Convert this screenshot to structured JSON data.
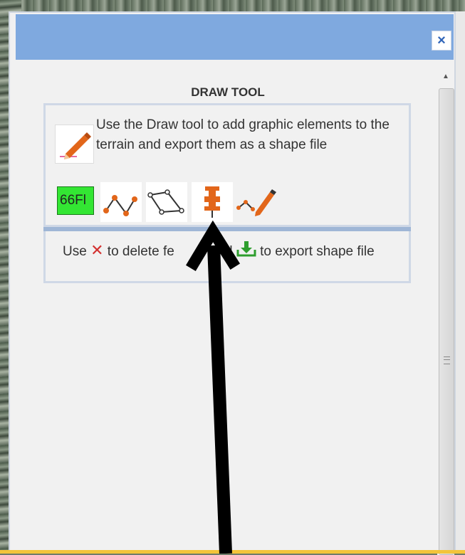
{
  "panel": {
    "close_label": "×",
    "title": "DRAW TOOL",
    "intro_text": "Use the Draw tool to add graphic elements to the terrain and export them as a shape file",
    "tools": [
      {
        "name": "text",
        "label": "66Fl"
      },
      {
        "name": "polyline",
        "icon": "polyline-icon"
      },
      {
        "name": "polygon",
        "icon": "polygon-icon"
      },
      {
        "name": "point",
        "icon": "pin-icon"
      },
      {
        "name": "freehand",
        "icon": "freehand-pencil-icon"
      }
    ],
    "help_text_prefix": "Use",
    "help_text_middle": "to delete fe",
    "help_text_middle2": "and",
    "help_text_suffix": "to export shape file"
  },
  "colors": {
    "header": "#7fa9df",
    "accent_orange": "#e2661a",
    "delete_red": "#d3302f",
    "export_green": "#2e9e2e",
    "text_tool_bg": "#33e633"
  }
}
